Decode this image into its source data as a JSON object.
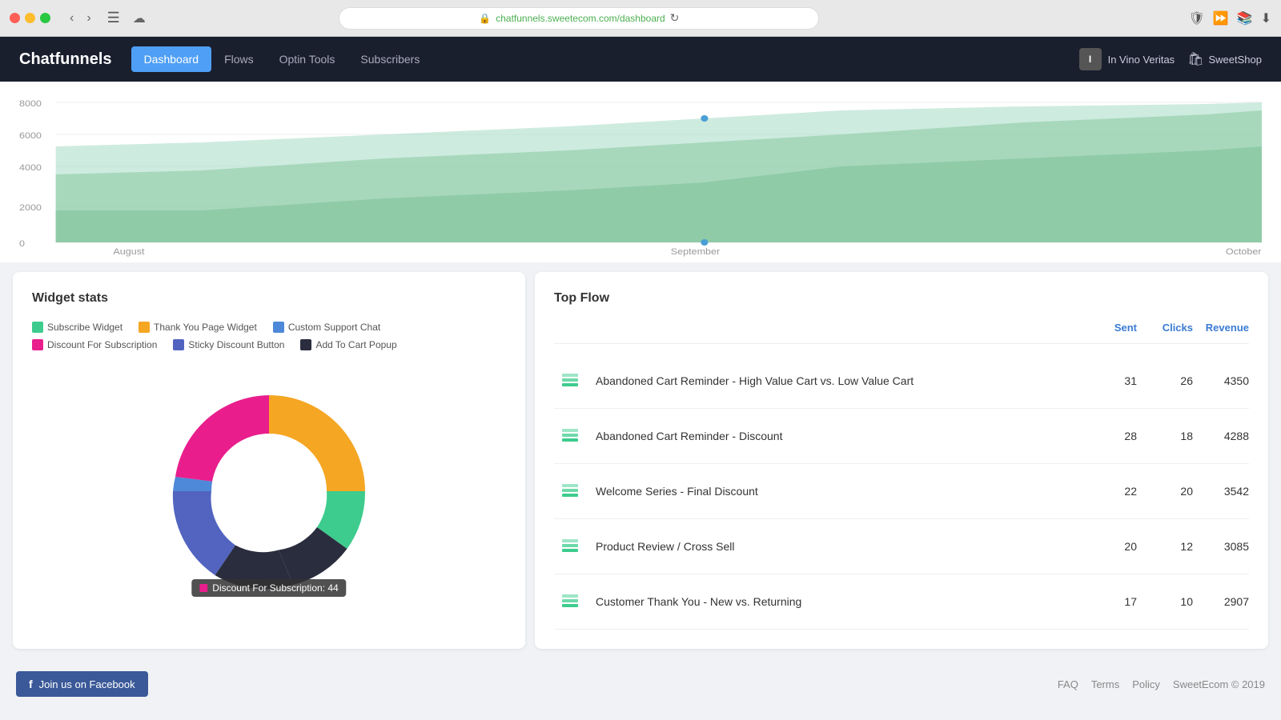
{
  "browser": {
    "url": "chatfunnels.sweetecom.com/dashboard",
    "url_display": "chatfunnels.sweetecom.com/dashboard"
  },
  "app": {
    "logo": "Chatfunnels",
    "nav": [
      {
        "label": "Dashboard",
        "active": true
      },
      {
        "label": "Flows",
        "active": false
      },
      {
        "label": "Optin Tools",
        "active": false
      },
      {
        "label": "Subscribers",
        "active": false
      }
    ],
    "user": "In Vino Veritas",
    "user_initial": "I",
    "shop": "SweetShop"
  },
  "chart": {
    "y_labels": [
      "8000",
      "6000",
      "4000",
      "2000",
      "0"
    ],
    "x_labels": [
      "August",
      "September",
      "October"
    ]
  },
  "widget_stats": {
    "title": "Widget stats",
    "legend": [
      {
        "label": "Subscribe Widget",
        "color": "#3dcc8e"
      },
      {
        "label": "Thank You Page Widget",
        "color": "#f5a623"
      },
      {
        "label": "Custom Support Chat",
        "color": "#4e88d9"
      },
      {
        "label": "Discount For Subscription",
        "color": "#e91e8c"
      },
      {
        "label": "Sticky Discount Button",
        "color": "#5264c0"
      },
      {
        "label": "Add To Cart Popup",
        "color": "#2a2d3e"
      }
    ],
    "donut_tooltip": "Discount For Subscription: 44",
    "donut_tooltip_color": "#e91e8c"
  },
  "top_flow": {
    "title": "Top Flow",
    "headers": [
      "Sent",
      "Clicks",
      "Revenue"
    ],
    "rows": [
      {
        "name": "Abandoned Cart Reminder - High Value Cart vs. Low Value Cart",
        "sent": 31,
        "clicks": 26,
        "revenue": 4350
      },
      {
        "name": "Abandoned Cart Reminder - Discount",
        "sent": 28,
        "clicks": 18,
        "revenue": 4288
      },
      {
        "name": "Welcome Series - Final Discount",
        "sent": 22,
        "clicks": 20,
        "revenue": 3542
      },
      {
        "name": "Product Review / Cross Sell",
        "sent": 20,
        "clicks": 12,
        "revenue": 3085
      },
      {
        "name": "Customer Thank You - New vs. Returning",
        "sent": 17,
        "clicks": 10,
        "revenue": 2907
      }
    ]
  },
  "footer": {
    "fb_button": "Join us on Facebook",
    "links": [
      "FAQ",
      "Terms",
      "Policy"
    ],
    "copyright": "SweetEcom © 2019"
  }
}
